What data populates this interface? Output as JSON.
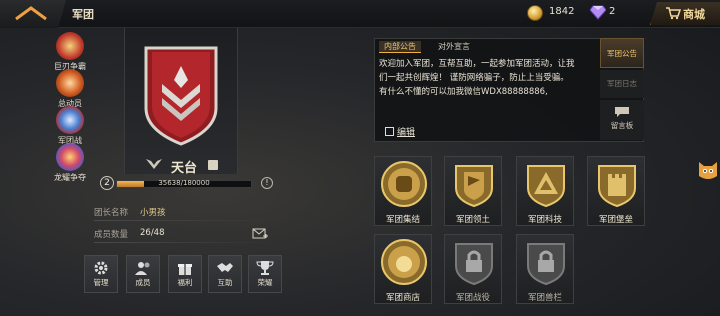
{
  "header": {
    "title": "军团",
    "coins": "1842",
    "gems": "2",
    "shop_label": "商城"
  },
  "side_menu": [
    {
      "label": "巨刃争霸",
      "icon": "blade-war-icon"
    },
    {
      "label": "总动员",
      "icon": "mobilize-icon"
    },
    {
      "label": "军团战",
      "icon": "legion-war-icon"
    },
    {
      "label": "龙耀争夺",
      "icon": "dragon-glory-icon"
    }
  ],
  "guild": {
    "name": "天台",
    "level": "2",
    "exp_text": "35638/180000",
    "exp_progress": 0.198,
    "leader_label": "团长名称",
    "leader_value": "小男孩",
    "members_label": "成员数量",
    "members_value": "26/48"
  },
  "actions": [
    {
      "label": "管理"
    },
    {
      "label": "成员"
    },
    {
      "label": "福利"
    },
    {
      "label": "互助"
    },
    {
      "label": "荣耀"
    }
  ],
  "notice": {
    "tabs": [
      "内部公告",
      "对外宣言"
    ],
    "lines": [
      "欢迎加入军团，互帮互助，一起参加军团活动，让我",
      "们一起共创辉煌！ 谨防网络骗子，防止上当受骗。",
      "有什么不懂的可以加我微信WDX88888886,"
    ],
    "edit_label": "编辑",
    "side_tabs": [
      "军团公告",
      "军团日志",
      "留言板"
    ]
  },
  "functions": [
    {
      "label": "军团集结",
      "locked": false
    },
    {
      "label": "军团领土",
      "locked": false
    },
    {
      "label": "军团科技",
      "locked": false
    },
    {
      "label": "军团堡垒",
      "locked": false
    },
    {
      "label": "军团商店",
      "locked": false
    },
    {
      "label": "军团战役",
      "locked": true
    },
    {
      "label": "军团兽栏",
      "locked": true
    }
  ],
  "colors": {
    "accent": "#f0b040",
    "gold": "#e3c98e",
    "emblem_red": "#b3262b"
  }
}
